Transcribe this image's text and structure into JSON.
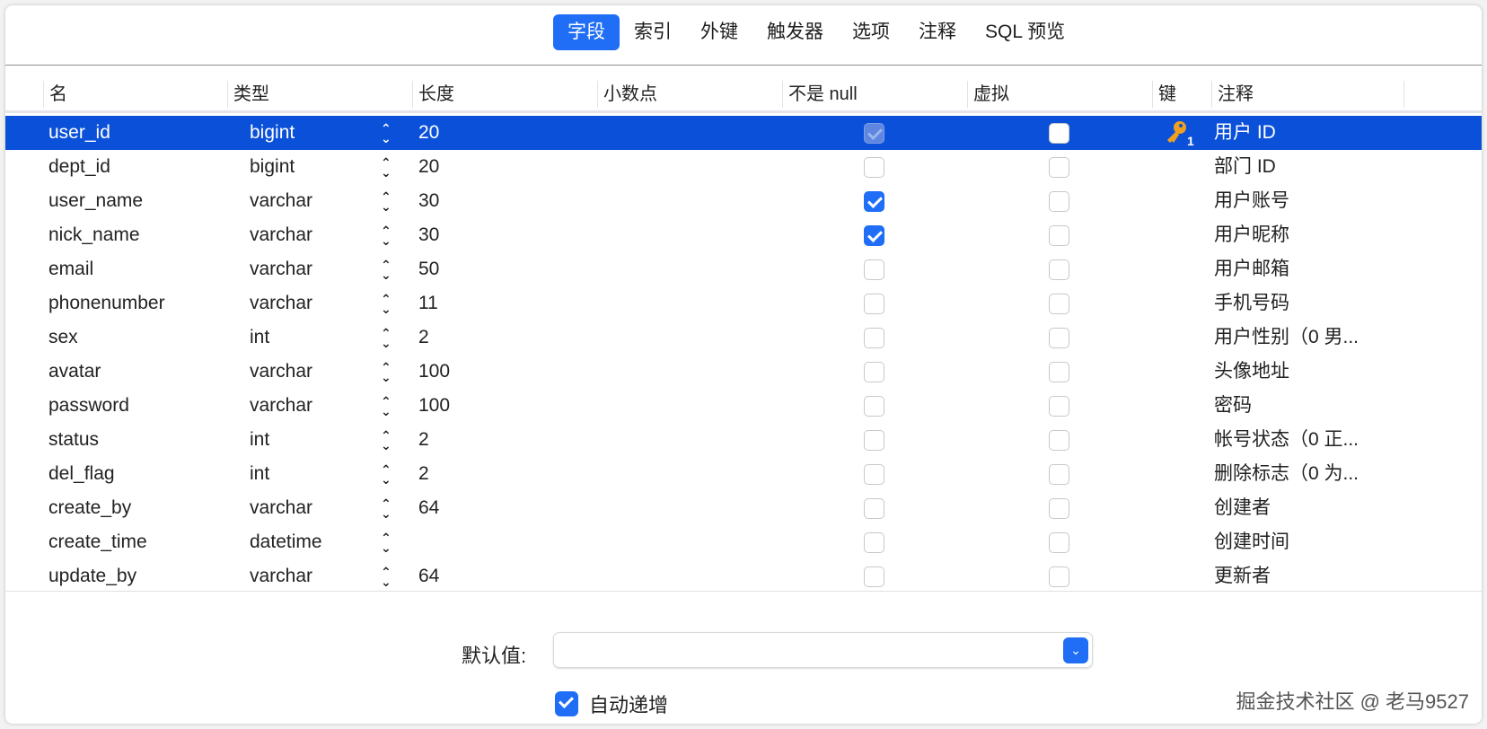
{
  "tabs": [
    "字段",
    "索引",
    "外键",
    "触发器",
    "选项",
    "注释",
    "SQL 预览"
  ],
  "columns": [
    "名",
    "类型",
    "长度",
    "小数点",
    "不是 null",
    "虚拟",
    "键",
    "注释"
  ],
  "rows": [
    {
      "name": "user_id",
      "type": "bigint",
      "length": "20",
      "not_null": true,
      "virtual": false,
      "key": "1",
      "comment": "用户 ID"
    },
    {
      "name": "dept_id",
      "type": "bigint",
      "length": "20",
      "not_null": false,
      "virtual": false,
      "key": "",
      "comment": "部门 ID"
    },
    {
      "name": "user_name",
      "type": "varchar",
      "length": "30",
      "not_null": true,
      "virtual": false,
      "key": "",
      "comment": "用户账号"
    },
    {
      "name": "nick_name",
      "type": "varchar",
      "length": "30",
      "not_null": true,
      "virtual": false,
      "key": "",
      "comment": "用户昵称"
    },
    {
      "name": "email",
      "type": "varchar",
      "length": "50",
      "not_null": false,
      "virtual": false,
      "key": "",
      "comment": "用户邮箱"
    },
    {
      "name": "phonenumber",
      "type": "varchar",
      "length": "11",
      "not_null": false,
      "virtual": false,
      "key": "",
      "comment": "手机号码"
    },
    {
      "name": "sex",
      "type": "int",
      "length": "2",
      "not_null": false,
      "virtual": false,
      "key": "",
      "comment": "用户性别（0 男..."
    },
    {
      "name": "avatar",
      "type": "varchar",
      "length": "100",
      "not_null": false,
      "virtual": false,
      "key": "",
      "comment": "头像地址"
    },
    {
      "name": "password",
      "type": "varchar",
      "length": "100",
      "not_null": false,
      "virtual": false,
      "key": "",
      "comment": "密码"
    },
    {
      "name": "status",
      "type": "int",
      "length": "2",
      "not_null": false,
      "virtual": false,
      "key": "",
      "comment": "帐号状态（0 正..."
    },
    {
      "name": "del_flag",
      "type": "int",
      "length": "2",
      "not_null": false,
      "virtual": false,
      "key": "",
      "comment": "删除标志（0 为..."
    },
    {
      "name": "create_by",
      "type": "varchar",
      "length": "64",
      "not_null": false,
      "virtual": false,
      "key": "",
      "comment": "创建者"
    },
    {
      "name": "create_time",
      "type": "datetime",
      "length": "",
      "not_null": false,
      "virtual": false,
      "key": "",
      "comment": "创建时间"
    },
    {
      "name": "update_by",
      "type": "varchar",
      "length": "64",
      "not_null": false,
      "virtual": false,
      "key": "",
      "comment": "更新者"
    }
  ],
  "selected_row": 0,
  "footer": {
    "default_label": "默认值:",
    "default_value": "",
    "auto_increment_label": "自动递增",
    "auto_increment": true
  },
  "watermark": "掘金技术社区 @ 老马9527",
  "colors": {
    "accent": "#1f6ef5",
    "selection": "#0b50d9",
    "key": "#f0a020"
  }
}
